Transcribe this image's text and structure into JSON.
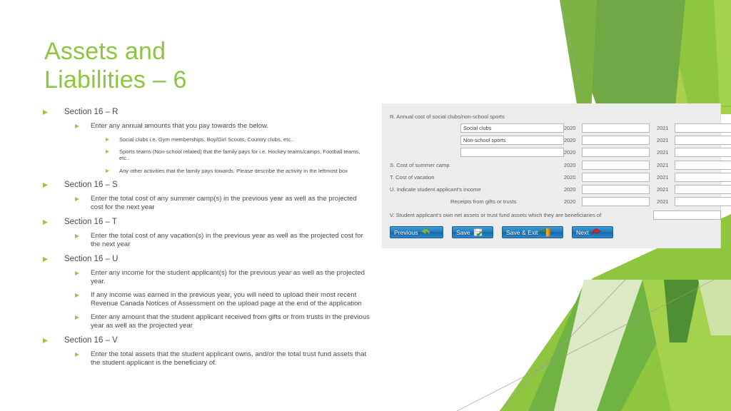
{
  "slide": {
    "title": "Assets and\nLiabilities – 6",
    "title_color": "#8CC63E",
    "background_color": "#FFFFFF",
    "bullet_marker_color": "#9DC348",
    "body_text_color": "#4A4A4A"
  },
  "bullets": [
    {
      "level": 1,
      "text": "Section 16 – R"
    },
    {
      "level": 2,
      "text": "Enter any annual amounts that you pay towards the below."
    },
    {
      "level": 3,
      "text": "Social clubs i.e. Gym memberships, Boy/Girl Scouts, Country clubs, etc.."
    },
    {
      "level": 3,
      "text": "Sports teams (Non-school related) that the family pays for i.e. Hockey teams/camps, Football teams, etc.."
    },
    {
      "level": 3,
      "text": "Any other activities that the family pays towards. Please describe the activity in the leftmost box"
    },
    {
      "level": 1,
      "text": "Section 16 – S"
    },
    {
      "level": 2,
      "text": "Enter the total cost of any summer camp(s) in the previous year as well as the projected cost for the next year"
    },
    {
      "level": 1,
      "text": "Section 16 – T"
    },
    {
      "level": 2,
      "text": "Enter the total cost of any vacation(s) in the previous year as well as the projected cost for the next year"
    },
    {
      "level": 1,
      "text": "Section 16 – U"
    },
    {
      "level": 2,
      "text": "Enter any income for the student applicant(s) for the previous year as well as the projected year."
    },
    {
      "level": 2,
      "text": "If any income was earned in the previous year, you will need to upload their most recent Revenue Canada Notices of Assessment on the upload page at the end of the application"
    },
    {
      "level": 2,
      "text": "Enter any amount that the student applicant received from gifts or from trusts in the previous year as well as the projected year"
    },
    {
      "level": 1,
      "text": "Section 16 – V"
    },
    {
      "level": 2,
      "text": "Enter the total assets that the student applicant owns, and/or the total trust fund assets that the student applicant is the beneficiary of."
    }
  ],
  "form": {
    "section_r_heading": "R. Annual cost of social clubs/non-school sports",
    "r_category_inputs": [
      {
        "value": "Social clubs"
      },
      {
        "value": "Non-school sports"
      },
      {
        "value": ""
      }
    ],
    "section_s_heading": "S. Cost of summer camp",
    "section_t_heading": "T. Cost of vacation",
    "section_u_heading": "U. Indicate student applicant's income",
    "u_sub_heading": "Receipts from gifts or trusts",
    "section_v_heading": "V. Student applicant's own net assets or trust fund assets which they are beneficiaries of",
    "year_prev": "2020",
    "year_next": "2021",
    "amount_rows": [
      {
        "prev_year": "2020",
        "prev_value": "",
        "next_year": "2021",
        "next_value": ""
      },
      {
        "prev_year": "2020",
        "prev_value": "",
        "next_year": "2021",
        "next_value": ""
      },
      {
        "prev_year": "2020",
        "prev_value": "",
        "next_year": "2021",
        "next_value": ""
      },
      {
        "prev_year": "2020",
        "prev_value": "",
        "next_year": "2021",
        "next_value": ""
      },
      {
        "prev_year": "2020",
        "prev_value": "",
        "next_year": "2021",
        "next_value": ""
      },
      {
        "prev_year": "2020",
        "prev_value": "",
        "next_year": "2021",
        "next_value": ""
      },
      {
        "prev_year": "2020",
        "prev_value": "",
        "next_year": "2021",
        "next_value": ""
      }
    ],
    "v_input_value": "",
    "buttons": [
      {
        "label": "Previous",
        "icon": "back-arrow-icon"
      },
      {
        "label": "Save",
        "icon": "floppy-disk-icon"
      },
      {
        "label": "Save & Exit",
        "icon": "exit-door-icon"
      },
      {
        "label": "Next",
        "icon": "forward-arrow-icon"
      }
    ],
    "button_color": "#1F78BD"
  }
}
